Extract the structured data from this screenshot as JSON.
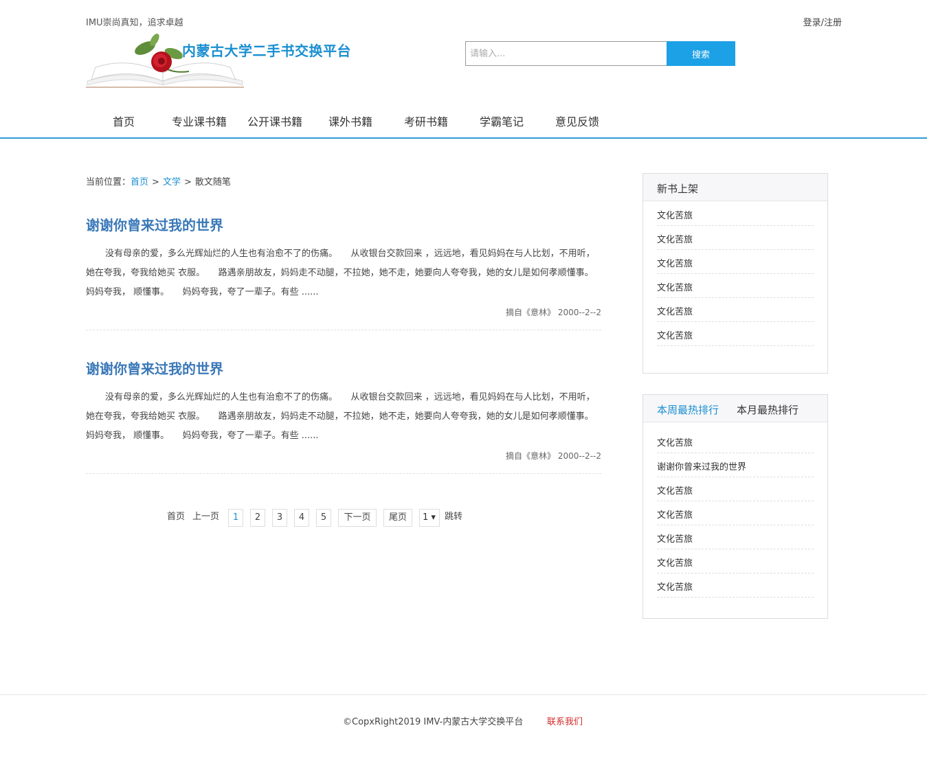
{
  "header": {
    "slogan": "IMU崇尚真知，追求卓越",
    "login_label": "登录/注册",
    "logo_title": "内蒙古大学二手书交换平台",
    "search": {
      "placeholder": "请输入...",
      "button_label": "搜索"
    }
  },
  "nav": {
    "items": [
      {
        "label": "首页"
      },
      {
        "label": "专业课书籍"
      },
      {
        "label": "公开课书籍"
      },
      {
        "label": "课外书籍"
      },
      {
        "label": "考研书籍"
      },
      {
        "label": "学霸笔记"
      },
      {
        "label": "意见反馈"
      }
    ]
  },
  "breadcrumb": {
    "prefix": "当前位置：",
    "home": "首页",
    "category": "文学",
    "current": "散文随笔",
    "separator": ">"
  },
  "articles": [
    {
      "title": "谢谢你曾来过我的世界",
      "body": "没有母亲的爱，多么光辉灿烂的人生也有治愈不了的伤痛。　　从收银台交款回来 ，远远地，看见妈妈在与人比划，不用听，她在夸我，夸我给她买 衣服。　　路遇亲朋故友，妈妈走不动腿，不拉她，她不走，她要向人夸夸我，她的女儿是如何孝顺懂事。　　妈妈夸我， 顺懂事。　　妈妈夸我，夸了一辈子。有些 ......",
      "meta": "摘自《意林》 2000--2--2"
    },
    {
      "title": "谢谢你曾来过我的世界",
      "body": "没有母亲的爱，多么光辉灿烂的人生也有治愈不了的伤痛。　　从收银台交款回来 ，远远地，看见妈妈在与人比划，不用听，她在夸我，夸我给她买 衣服。　　路遇亲朋故友，妈妈走不动腿，不拉她，她不走，她要向人夸夸我，她的女儿是如何孝顺懂事。　　妈妈夸我， 顺懂事。　　妈妈夸我，夸了一辈子。有些 ......",
      "meta": "摘自《意林》 2000--2--2"
    }
  ],
  "pagination": {
    "first": "首页",
    "prev": "上一页",
    "pages": [
      "1",
      "2",
      "3",
      "4",
      "5"
    ],
    "current_page": "1",
    "next": "下一页",
    "last": "尾页",
    "select_value": "1 ▾",
    "jump": "跳转"
  },
  "sidebar": {
    "new_books": {
      "title": "新书上架",
      "items": [
        "文化苦旅",
        "文化苦旅",
        "文化苦旅",
        "文化苦旅",
        "文化苦旅",
        "文化苦旅"
      ]
    },
    "rankings": {
      "tab_week": "本周最热排行",
      "tab_month": "本月最热排行",
      "items": [
        "文化苦旅",
        "谢谢你曾来过我的世界",
        "文化苦旅",
        "文化苦旅",
        "文化苦旅",
        "文化苦旅",
        "文化苦旅"
      ]
    }
  },
  "footer": {
    "copyright": "©CopxRight2019 IMV-内蒙古大学交换平台",
    "contact": "联系我们"
  },
  "colors": {
    "accent": "#1ca0e6",
    "link": "#1a8fd0",
    "title": "#3a78b8",
    "contact": "#d42a2a"
  }
}
